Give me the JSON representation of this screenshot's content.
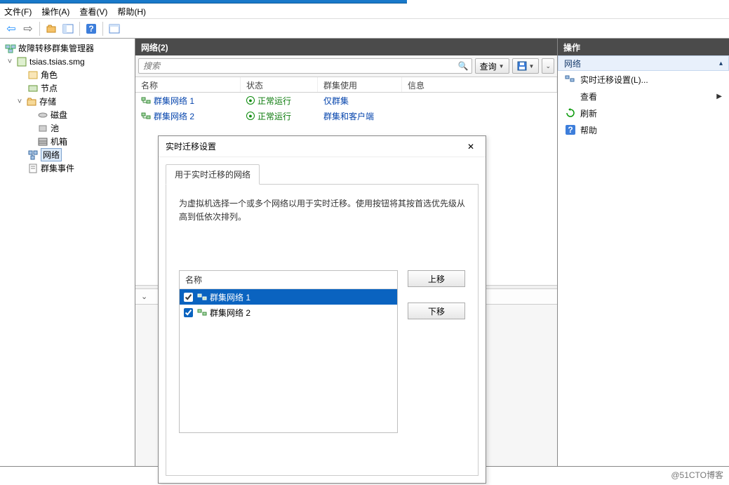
{
  "menu": {
    "file": "文件(F)",
    "action": "操作(A)",
    "view": "查看(V)",
    "help": "帮助(H)"
  },
  "tree": {
    "root": "故障转移群集管理器",
    "cluster": "tsias.tsias.smg",
    "roles": "角色",
    "nodes": "节点",
    "storage": "存储",
    "disks": "磁盘",
    "pools": "池",
    "enclosures": "机箱",
    "networks": "网络",
    "events": "群集事件"
  },
  "center": {
    "header": "网络(2)",
    "search_placeholder": "搜索",
    "query_btn": "查询",
    "columns": {
      "name": "名称",
      "status": "状态",
      "usage": "群集使用",
      "info": "信息"
    },
    "rows": [
      {
        "name": "群集网络 1",
        "status": "正常运行",
        "usage": "仅群集"
      },
      {
        "name": "群集网络 2",
        "status": "正常运行",
        "usage": "群集和客户端"
      }
    ]
  },
  "actions": {
    "title": "操作",
    "group": "网络",
    "live_migration": "实时迁移设置(L)...",
    "view": "查看",
    "refresh": "刷新",
    "help": "帮助"
  },
  "dialog": {
    "title": "实时迁移设置",
    "tab": "用于实时迁移的网络",
    "instruction": "为虚拟机选择一个或多个网络以用于实时迁移。使用按钮将其按首选优先级从高到低依次排列。",
    "col_name": "名称",
    "items": [
      {
        "label": "群集网络 1",
        "checked": true,
        "selected": true
      },
      {
        "label": "群集网络 2",
        "checked": true,
        "selected": false
      }
    ],
    "btn_up": "上移",
    "btn_down": "下移"
  },
  "watermark": "@51CTO博客"
}
